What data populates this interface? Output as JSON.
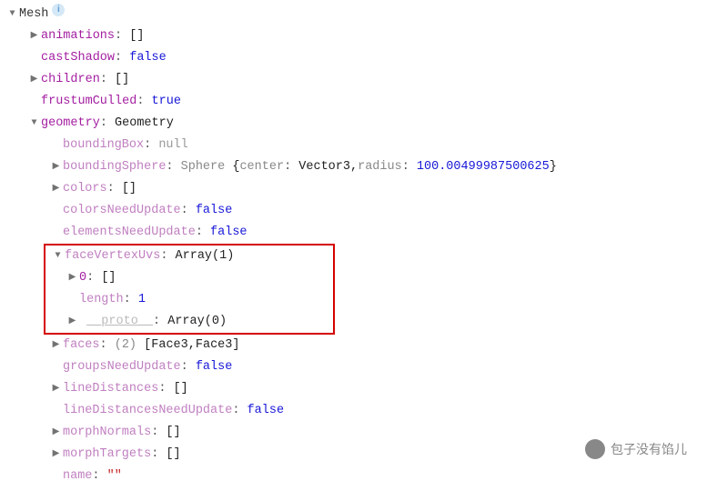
{
  "root": {
    "label": "Mesh"
  },
  "mesh": {
    "animations": {
      "key": "animations",
      "value": "[]"
    },
    "castShadow": {
      "key": "castShadow",
      "value": "false"
    },
    "children": {
      "key": "children",
      "value": "[]"
    },
    "frustumCulled": {
      "key": "frustumCulled",
      "value": "true"
    },
    "geometry": {
      "key": "geometry",
      "value": "Geometry"
    }
  },
  "geometry": {
    "boundingBox": {
      "key": "boundingBox",
      "value": "null"
    },
    "boundingSphere": {
      "key": "boundingSphere",
      "ctor": "Sphere",
      "open": "{",
      "p1key": "center",
      "p1val": "Vector3",
      "sep": ", ",
      "p2key": "radius",
      "p2val": "100.00499987500625",
      "close": "}"
    },
    "colors": {
      "key": "colors",
      "value": "[]"
    },
    "colorsNeedUpdate": {
      "key": "colorsNeedUpdate",
      "value": "false"
    },
    "elementsNeedUpdate": {
      "key": "elementsNeedUpdate",
      "value": "false"
    },
    "faceVertexUvs": {
      "key": "faceVertexUvs",
      "value": "Array(1)",
      "items": {
        "zero": {
          "key": "0",
          "value": "[]"
        },
        "length": {
          "key": "length",
          "value": "1"
        },
        "proto": {
          "key": "__proto__",
          "value": "Array(0)"
        }
      }
    },
    "faces": {
      "key": "faces",
      "count": "(2)",
      "open": "[",
      "a": "Face3",
      "sep": ", ",
      "b": "Face3",
      "close": "]"
    },
    "groupsNeedUpdate": {
      "key": "groupsNeedUpdate",
      "value": "false"
    },
    "lineDistances": {
      "key": "lineDistances",
      "value": "[]"
    },
    "lineDistancesNeedUpdate": {
      "key": "lineDistancesNeedUpdate",
      "value": "false"
    },
    "morphNormals": {
      "key": "morphNormals",
      "value": "[]"
    },
    "morphTargets": {
      "key": "morphTargets",
      "value": "[]"
    },
    "name": {
      "key": "name",
      "value": "\"\""
    }
  },
  "watermark": {
    "text": "包子没有馅儿"
  }
}
